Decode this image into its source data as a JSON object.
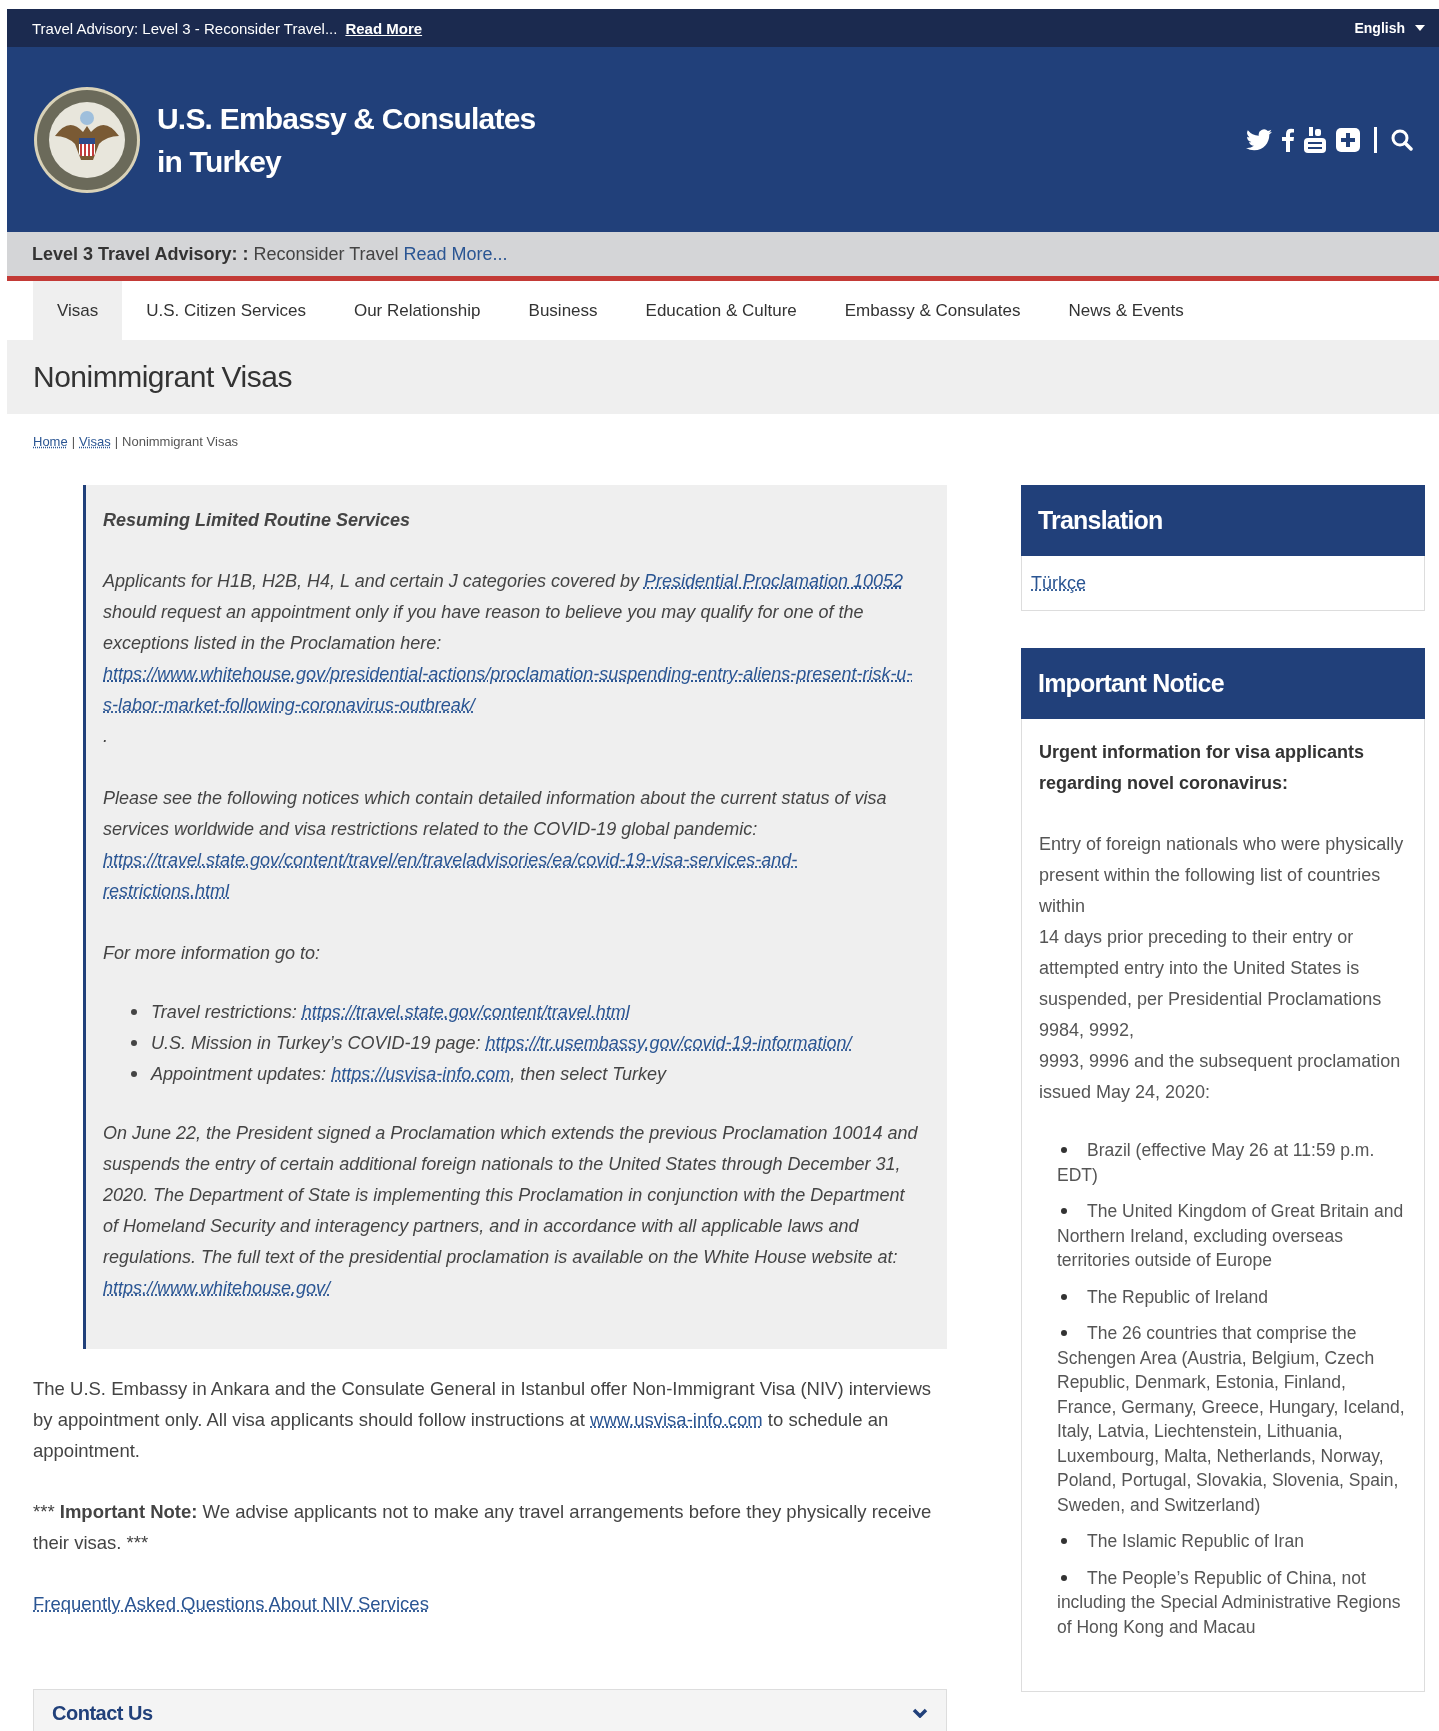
{
  "top_bar": {
    "text": "Travel Advisory: Level 3 - Reconsider Travel...",
    "link": "Read More",
    "language": "English"
  },
  "header": {
    "title": "U.S. Embassy & Consulates\nin Turkey"
  },
  "advisory_bar": {
    "label": "Level 3 Travel Advisory: :",
    "text": "Reconsider Travel",
    "link": "Read More..."
  },
  "nav": [
    {
      "label": "Visas",
      "selected": true
    },
    {
      "label": "U.S. Citizen Services",
      "selected": false
    },
    {
      "label": "Our Relationship",
      "selected": false
    },
    {
      "label": "Business",
      "selected": false
    },
    {
      "label": "Education & Culture",
      "selected": false
    },
    {
      "label": "Embassy & Consulates",
      "selected": false
    },
    {
      "label": "News & Events",
      "selected": false
    }
  ],
  "page_title": "Nonimmigrant Visas",
  "breadcrumb": {
    "separator": "|",
    "items": [
      {
        "label": "Home",
        "kind": "link"
      },
      {
        "label": "Visas",
        "kind": "link"
      },
      {
        "label": "Nonimmigrant Visas",
        "kind": "current"
      }
    ]
  },
  "callout": {
    "title": "Resuming Limited Routine Services",
    "blocks": [
      {
        "kind": "paragraph",
        "parts": [
          {
            "kind": "text",
            "text": "Applicants for H1B, H2B, H4, L and certain J categories covered by "
          },
          {
            "kind": "link",
            "text": "Presidential Proclamation 10052"
          },
          {
            "kind": "text",
            "text": " should request an appointment only if you have reason to believe you may qualify for one of the exceptions listed in the Proclamation here: "
          },
          {
            "kind": "link",
            "text": "https://www.whitehouse.gov/presidential-actions/proclamation-suspending-entry-aliens-present-risk-u-s-labor-market-following-coronavirus-outbreak/"
          },
          {
            "kind": "text",
            "text": "."
          }
        ]
      },
      {
        "kind": "paragraph",
        "parts": [
          {
            "kind": "text",
            "text": "Please see the following notices which contain detailed information about the current status of visa services worldwide and visa restrictions related to the COVID-19 global pandemic: "
          },
          {
            "kind": "link",
            "text": "https://travel.state.gov/content/travel/en/traveladvisories/ea/covid-19-visa-services-and-restrictions.html"
          }
        ]
      },
      {
        "kind": "paragraph",
        "parts": [
          {
            "kind": "text",
            "text": "For more information go to:"
          }
        ]
      },
      {
        "kind": "list",
        "items": [
          {
            "parts": [
              {
                "kind": "text",
                "text": "Travel restrictions: "
              },
              {
                "kind": "link",
                "text": "https://travel.state.gov/content/travel.html"
              }
            ]
          },
          {
            "parts": [
              {
                "kind": "text",
                "text": "U.S. Mission in Turkey’s COVID-19 page: "
              },
              {
                "kind": "link",
                "text": "https://tr.usembassy.gov/covid-19-information/"
              }
            ]
          },
          {
            "parts": [
              {
                "kind": "text",
                "text": "Appointment updates: "
              },
              {
                "kind": "link",
                "text": "https://usvisa-info.com"
              },
              {
                "kind": "text",
                "text": ", then select Turkey"
              }
            ]
          }
        ]
      },
      {
        "kind": "paragraph",
        "parts": [
          {
            "kind": "text",
            "text": "On June 22, the President signed a Proclamation which extends the previous Proclamation 10014 and suspends the entry of certain additional foreign nationals to the United States through December 31, 2020. The Department of State is implementing this Proclamation in conjunction with the Department of Homeland Security and interagency partners, and in accordance with all applicable laws and regulations. The full text of the presidential proclamation is available on the White House website at: "
          },
          {
            "kind": "link",
            "text": "https://www.whitehouse.gov/"
          }
        ]
      }
    ]
  },
  "body": [
    {
      "kind": "paragraph",
      "parts": [
        {
          "kind": "text",
          "text": "The U.S. Embassy in Ankara and the Consulate General in Istanbul offer Non-Immigrant Visa (NIV) interviews by appointment only. All visa applicants should follow instructions at "
        },
        {
          "kind": "link",
          "text": "www.usvisa-info.com"
        },
        {
          "kind": "text",
          "text": " to schedule an appointment."
        }
      ]
    },
    {
      "kind": "paragraph",
      "parts": [
        {
          "kind": "text",
          "text": "*** "
        },
        {
          "kind": "bold",
          "text": "Important Note:"
        },
        {
          "kind": "text",
          "text": " We advise applicants not to make any travel arrangements before they physically receive their visas. ***"
        }
      ]
    },
    {
      "kind": "paragraph",
      "parts": [
        {
          "kind": "link",
          "text": "Frequently Asked Questions About NIV Services"
        }
      ]
    }
  ],
  "contact": {
    "title": "Contact Us",
    "expanded": false
  },
  "sidebar": {
    "translation": {
      "title": "Translation",
      "link": "Türkçe"
    },
    "notice": {
      "title": "Important Notice",
      "heading": "Urgent information for visa applicants regarding novel coronavirus:",
      "text": "Entry of foreign nationals who were physically present within the following list of countries within\n14 days prior preceding to their entry or attempted entry into the United States is suspended, per Presidential Proclamations 9984, 9992,\n9993, 9996 and the subsequent proclamation issued May 24, 2020:",
      "items": [
        "Brazil (effective May 26 at 11:59 p.m. EDT)",
        "The United Kingdom of Great Britain and Northern Ireland, excluding overseas territories outside of Europe",
        "The Republic of Ireland",
        "The 26 countries that comprise the Schengen Area (Austria, Belgium, Czech Republic, Denmark, Estonia, Finland, France, Germany, Greece, Hungary, Iceland, Italy, Latvia, Liechtenstein, Lithuania, Luxembourg, Malta, Netherlands, Norway, Poland, Portugal, Slovakia, Slovenia, Spain, Sweden, and Switzerland)",
        "The Islamic Republic of Iran",
        "The People’s Republic of China, not including the Special Administrative Regions of Hong Kong and Macau"
      ]
    }
  }
}
